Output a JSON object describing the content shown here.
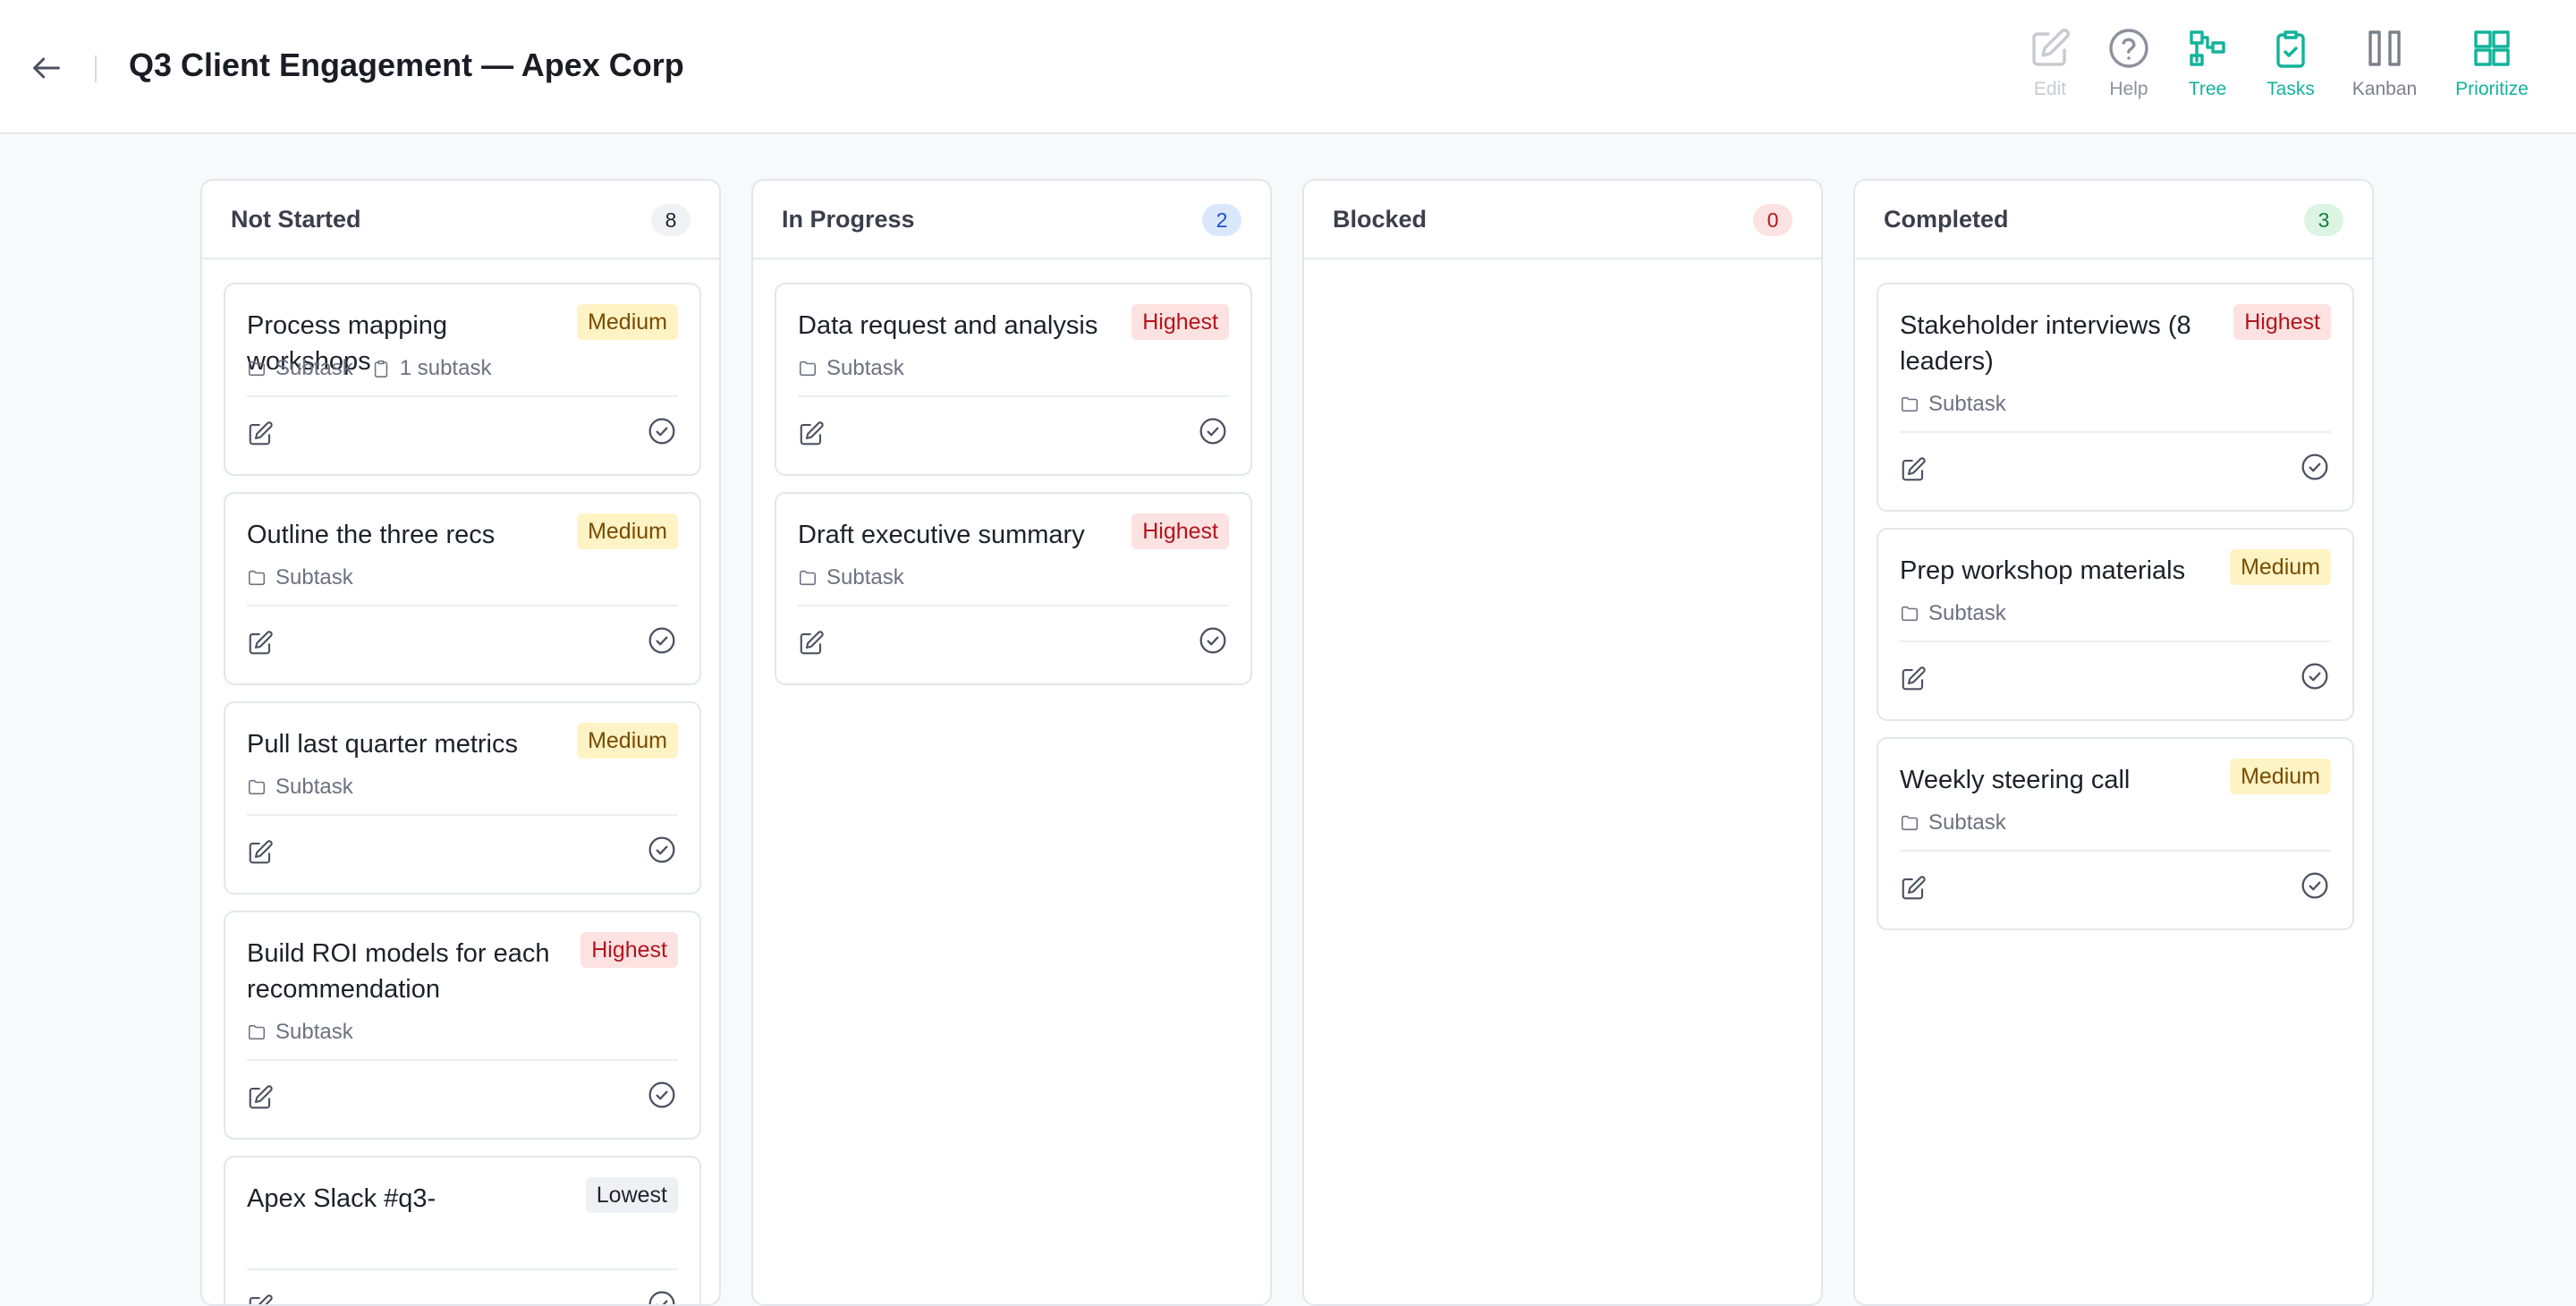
{
  "header": {
    "title": "Q3 Client Engagement — Apex Corp",
    "back_icon": "arrow-left-icon",
    "tools": [
      {
        "key": "edit",
        "label": "Edit",
        "icon": "pencil-square-icon",
        "color": "#c7cad1"
      },
      {
        "key": "help",
        "label": "Help",
        "icon": "help-circle-icon",
        "color": "#8b919c"
      },
      {
        "key": "tree",
        "label": "Tree",
        "icon": "tree-icon",
        "color": "#12b39b"
      },
      {
        "key": "tasks",
        "label": "Tasks",
        "icon": "clipboard-check-icon",
        "color": "#12b39b"
      },
      {
        "key": "kanban",
        "label": "Kanban",
        "icon": "columns-icon",
        "color": "#7a808b"
      },
      {
        "key": "prioritize",
        "label": "Prioritize",
        "icon": "grid-icon",
        "color": "#12b39b"
      }
    ]
  },
  "columns": [
    {
      "title": "Not Started",
      "count": "8",
      "count_bg": "#f1f2f4",
      "count_color": "#1f2430",
      "cards": [
        {
          "title": "Process mapping workshops",
          "priority": "Medium",
          "meta": [
            "Subtask",
            "1 subtask"
          ]
        },
        {
          "title": "Outline the three recs",
          "priority": "Medium",
          "meta": [
            "Subtask"
          ]
        },
        {
          "title": "Pull last quarter metrics",
          "priority": "Medium",
          "meta": [
            "Subtask"
          ]
        },
        {
          "title": "Build ROI models for each recommendation",
          "priority": "Highest",
          "meta": [
            "Subtask"
          ]
        },
        {
          "title": "Apex Slack #q3-",
          "priority": "Lowest",
          "meta": []
        }
      ]
    },
    {
      "title": "In Progress",
      "count": "2",
      "count_bg": "#dbe8fb",
      "count_color": "#1d4ed8",
      "cards": [
        {
          "title": "Data request and analysis",
          "priority": "Highest",
          "meta": [
            "Subtask"
          ]
        },
        {
          "title": "Draft executive summary",
          "priority": "Highest",
          "meta": [
            "Subtask"
          ]
        }
      ]
    },
    {
      "title": "Blocked",
      "count": "0",
      "count_bg": "#fde2e2",
      "count_color": "#b3151c",
      "cards": []
    },
    {
      "title": "Completed",
      "count": "3",
      "count_bg": "#dcf5e3",
      "count_color": "#15803d",
      "cards": [
        {
          "title": "Stakeholder interviews (8 leaders)",
          "priority": "Highest",
          "meta": [
            "Subtask"
          ]
        },
        {
          "title": "Prep workshop materials",
          "priority": "Medium",
          "meta": [
            "Subtask"
          ]
        },
        {
          "title": "Weekly steering call",
          "priority": "Medium",
          "meta": [
            "Subtask"
          ]
        }
      ]
    }
  ]
}
